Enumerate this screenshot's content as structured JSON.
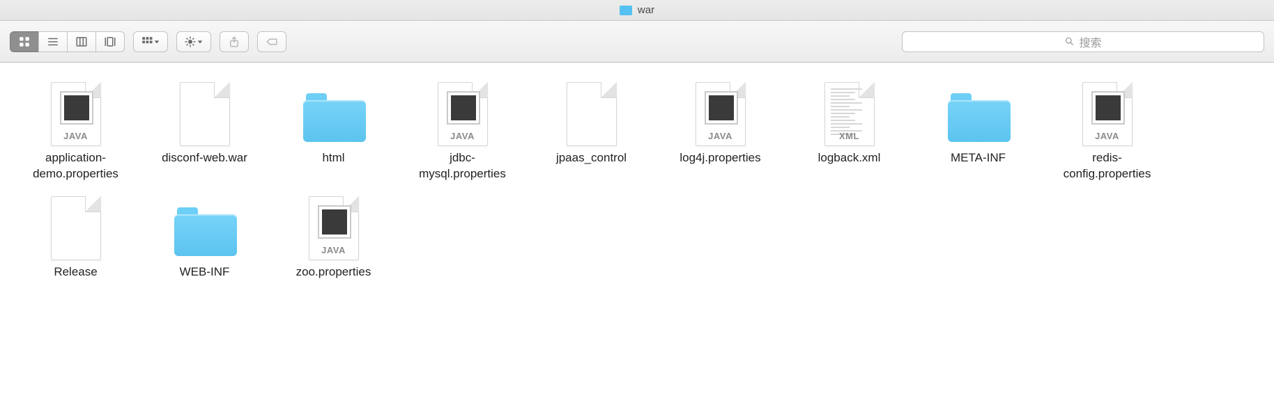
{
  "window": {
    "title": "war"
  },
  "toolbar": {
    "search_placeholder": "搜索"
  },
  "items": [
    {
      "name": "application-\ndemo.properties",
      "type": "java"
    },
    {
      "name": "disconf-web.war",
      "type": "file"
    },
    {
      "name": "html",
      "type": "folder"
    },
    {
      "name": "jdbc-\nmysql.properties",
      "type": "java"
    },
    {
      "name": "jpaas_control",
      "type": "file"
    },
    {
      "name": "log4j.properties",
      "type": "java"
    },
    {
      "name": "logback.xml",
      "type": "xml"
    },
    {
      "name": "META-INF",
      "type": "folder"
    },
    {
      "name": "redis-\nconfig.properties",
      "type": "java"
    },
    {
      "name": "Release",
      "type": "file"
    },
    {
      "name": "WEB-INF",
      "type": "folder"
    },
    {
      "name": "zoo.properties",
      "type": "java"
    }
  ],
  "badges": {
    "java": "JAVA",
    "xml": "XML"
  }
}
